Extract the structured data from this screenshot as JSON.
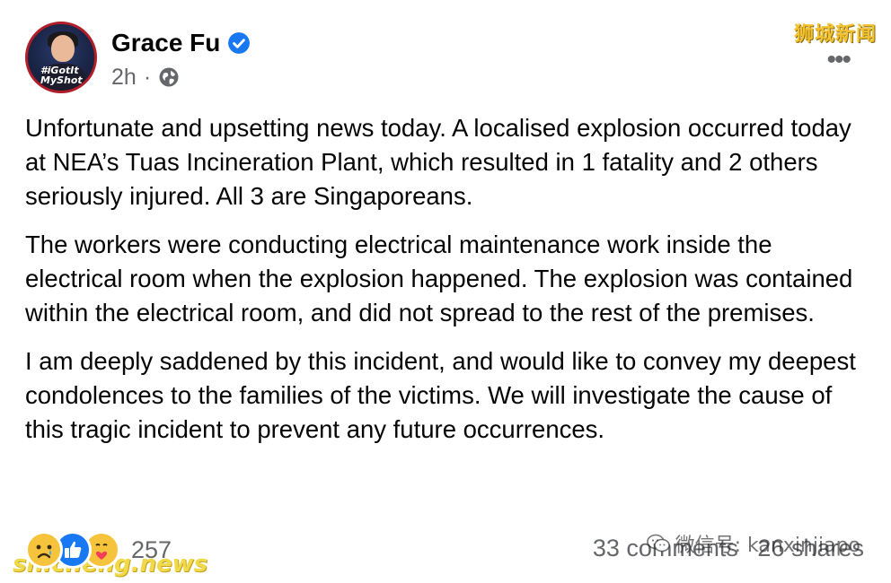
{
  "post": {
    "author_name": "Grace Fu",
    "time": "2h",
    "separator": "·",
    "audience_icon": "globe-icon",
    "verified_icon": "verified-badge-icon",
    "more_label": "•••",
    "avatar_tag_line1": "#iGotIt",
    "avatar_tag_line2": "MyShot",
    "paragraphs": [
      "Unfortunate and upsetting news today. A localised explosion occurred today at NEA’s Tuas Incineration Plant, which resulted in 1 fatality and 2 others seriously injured. All 3 are Singaporeans.",
      "The workers were conducting electrical maintenance work inside the electrical room when the explosion happened. The explosion was contained within the electrical room, and did not spread to the rest of the premises.",
      "I am deeply saddened by this incident, and would like to convey my deepest condolences to the families of the victims. We will investigate the cause of this tragic incident to prevent any future occurrences."
    ]
  },
  "footer": {
    "reaction_count": "257",
    "comments": "33 comments",
    "shares": "26 shares",
    "reaction_icons": [
      "sad-reaction-icon",
      "like-reaction-icon",
      "care-reaction-icon"
    ]
  },
  "watermarks": {
    "top_right": "狮城新闻",
    "bottom_left": "shicheng.news",
    "bottom_right": "微信号: kanxinjiapo"
  },
  "colors": {
    "text": "#050505",
    "secondary": "#65676b",
    "verified": "#1877f2",
    "like": "#1877f2",
    "reaction_yellow": "#f6c33d"
  }
}
